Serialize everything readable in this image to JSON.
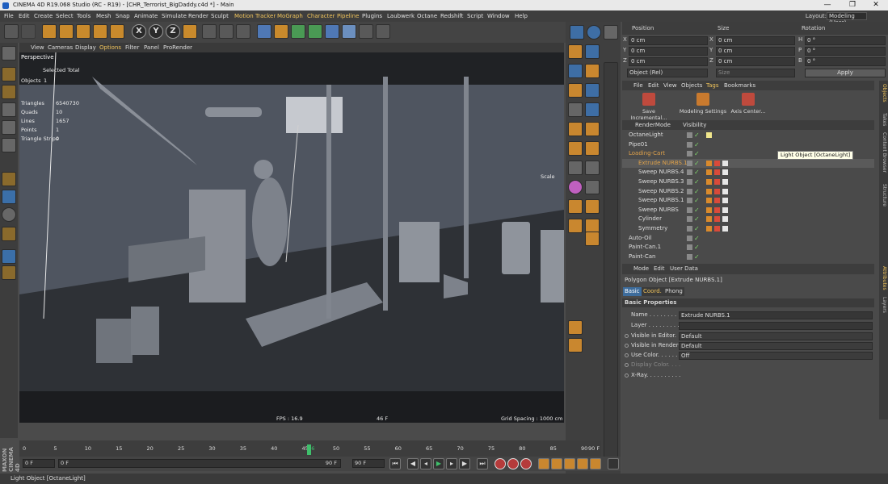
{
  "window": {
    "title": "CINEMA 4D R19.068 Studio (RC - R19) - [CHR_Terrorist_BigDaddy.c4d *] - Main",
    "controls": [
      "—",
      "❐",
      "✕"
    ]
  },
  "menubar": {
    "items": [
      "File",
      "Edit",
      "Create",
      "Select",
      "Tools",
      "Mesh",
      "Snap",
      "Animate",
      "Simulate",
      "Render",
      "Sculpt",
      "Motion Tracker",
      "MoGraph",
      "Character",
      "Pipeline",
      "Plugins",
      "Laubwerk",
      "Octane",
      "Redshift",
      "Script",
      "Window",
      "Help"
    ],
    "highlighted": [
      "Motion Tracker",
      "MoGraph",
      "Character",
      "Pipeline"
    ],
    "layout_label": "Layout:",
    "layout_value": "Modeling (User)"
  },
  "toolbar": {
    "xyz": [
      "X",
      "Y",
      "Z"
    ]
  },
  "viewport": {
    "menu": [
      "View",
      "Cameras",
      "Display",
      "Options",
      "Filter",
      "Panel",
      "ProRender"
    ],
    "active_menu": "Options",
    "label": "Perspective",
    "stats": {
      "header": "Selected Total",
      "objects_label": "Objects",
      "objects_value": "1",
      "rows": [
        {
          "label": "Triangles",
          "value": "6540730"
        },
        {
          "label": "Quads",
          "value": "10"
        },
        {
          "label": "Lines",
          "value": "1657"
        },
        {
          "label": "Points",
          "value": "1"
        },
        {
          "label": "Triangle Strips",
          "value": "0"
        }
      ]
    },
    "fps": "FPS : 16.9",
    "frame": "46 F",
    "grid_spacing": "Grid Spacing : 1000 cm",
    "scale_label": "Scale"
  },
  "coordinates": {
    "headers": [
      "Position",
      "Size",
      "Rotation"
    ],
    "rows": [
      {
        "axis": "X",
        "position": "0 cm",
        "size_axis": "X",
        "size": "0 cm",
        "rot_axis": "H",
        "rotation": "0 °"
      },
      {
        "axis": "Y",
        "position": "0 cm",
        "size_axis": "Y",
        "size": "0 cm",
        "rot_axis": "P",
        "rotation": "0 °"
      },
      {
        "axis": "Z",
        "position": "0 cm",
        "size_axis": "Z",
        "size": "0 cm",
        "rot_axis": "B",
        "rotation": "0 °"
      }
    ],
    "mode_select": "Object (Rel)",
    "size_select": "Size",
    "apply_label": "Apply"
  },
  "object_manager": {
    "menu": [
      "File",
      "Edit",
      "View",
      "Objects",
      "Tags",
      "Bookmarks"
    ],
    "active_menu": "Tags",
    "tools": [
      {
        "label": "Save Incremental..."
      },
      {
        "label": "Modeling Settings"
      },
      {
        "label": "Axis Center..."
      }
    ],
    "tabs": [
      "RenderMode",
      "Visibility"
    ],
    "objects": [
      {
        "name": "OctaneLight",
        "indent": 0,
        "orange": false,
        "selected": false
      },
      {
        "name": "Pipe01",
        "indent": 0,
        "orange": false,
        "selected": false
      },
      {
        "name": "Loading-Cart",
        "indent": 0,
        "orange": true,
        "selected": false
      },
      {
        "name": "Extrude NURBS.1",
        "indent": 1,
        "orange": true,
        "selected": true
      },
      {
        "name": "Sweep NURBS.4",
        "indent": 1,
        "orange": false,
        "selected": false
      },
      {
        "name": "Sweep NURBS.3",
        "indent": 1,
        "orange": false,
        "selected": false
      },
      {
        "name": "Sweep NURBS.2",
        "indent": 1,
        "orange": false,
        "selected": false
      },
      {
        "name": "Sweep NURBS.1",
        "indent": 1,
        "orange": false,
        "selected": false
      },
      {
        "name": "Sweep NURBS",
        "indent": 1,
        "orange": false,
        "selected": false
      },
      {
        "name": "Cylinder",
        "indent": 1,
        "orange": false,
        "selected": false
      },
      {
        "name": "Symmetry",
        "indent": 1,
        "orange": false,
        "selected": false
      },
      {
        "name": "Auto-Oil",
        "indent": 0,
        "orange": false,
        "selected": false
      },
      {
        "name": "Paint-Can.1",
        "indent": 0,
        "orange": false,
        "selected": false
      },
      {
        "name": "Paint-Can",
        "indent": 0,
        "orange": false,
        "selected": false
      }
    ],
    "tooltip": "Light Object [OctaneLight]"
  },
  "attributes": {
    "menu": [
      "Mode",
      "Edit",
      "User Data"
    ],
    "title": "Polygon Object [Extrude NURBS.1]",
    "tabs": [
      "Basic",
      "Coord.",
      "Phong"
    ],
    "active_tab": "Basic",
    "section": "Basic Properties",
    "fields": [
      {
        "label": "Name . . . . . . . . . . . . .",
        "value": "Extrude NURBS.1",
        "radio": false,
        "dim": false
      },
      {
        "label": "Layer . . . . . . . . . . . . .",
        "value": "",
        "radio": false,
        "dim": false
      },
      {
        "label": "Visible in Editor. . .",
        "value": "Default",
        "radio": true,
        "dim": false
      },
      {
        "label": "Visible in Renderer",
        "value": "Default",
        "radio": true,
        "dim": false
      },
      {
        "label": "Use Color. . . . . . . .",
        "value": "Off",
        "radio": true,
        "dim": false
      },
      {
        "label": "Display Color. . . .",
        "value": "",
        "radio": true,
        "dim": true
      },
      {
        "label": "X-Ray. . . . . . . . . .",
        "value": "",
        "radio": true,
        "dim": false
      }
    ]
  },
  "side_tabs": [
    "Objects",
    "Takes",
    "Content Browser",
    "Structure",
    "Attributes",
    "Layers"
  ],
  "timeline": {
    "ticks": [
      0,
      5,
      10,
      15,
      20,
      25,
      30,
      35,
      40,
      45,
      46,
      50,
      55,
      60,
      65,
      70,
      75,
      80,
      85,
      90
    ],
    "current_frame": 46,
    "end_label": "90 F"
  },
  "transport": {
    "start_field": "0 F",
    "range_start": "0 F",
    "range_end": "90 F",
    "end_field": "90 F"
  },
  "statusbar": {
    "text": "Light Object [OctaneLight]"
  },
  "branding": "MAXON CINEMA 4D",
  "colors": {
    "accent": "#f0c45c",
    "selection": "#3d6c9c",
    "playhead": "#3fbf6b"
  }
}
